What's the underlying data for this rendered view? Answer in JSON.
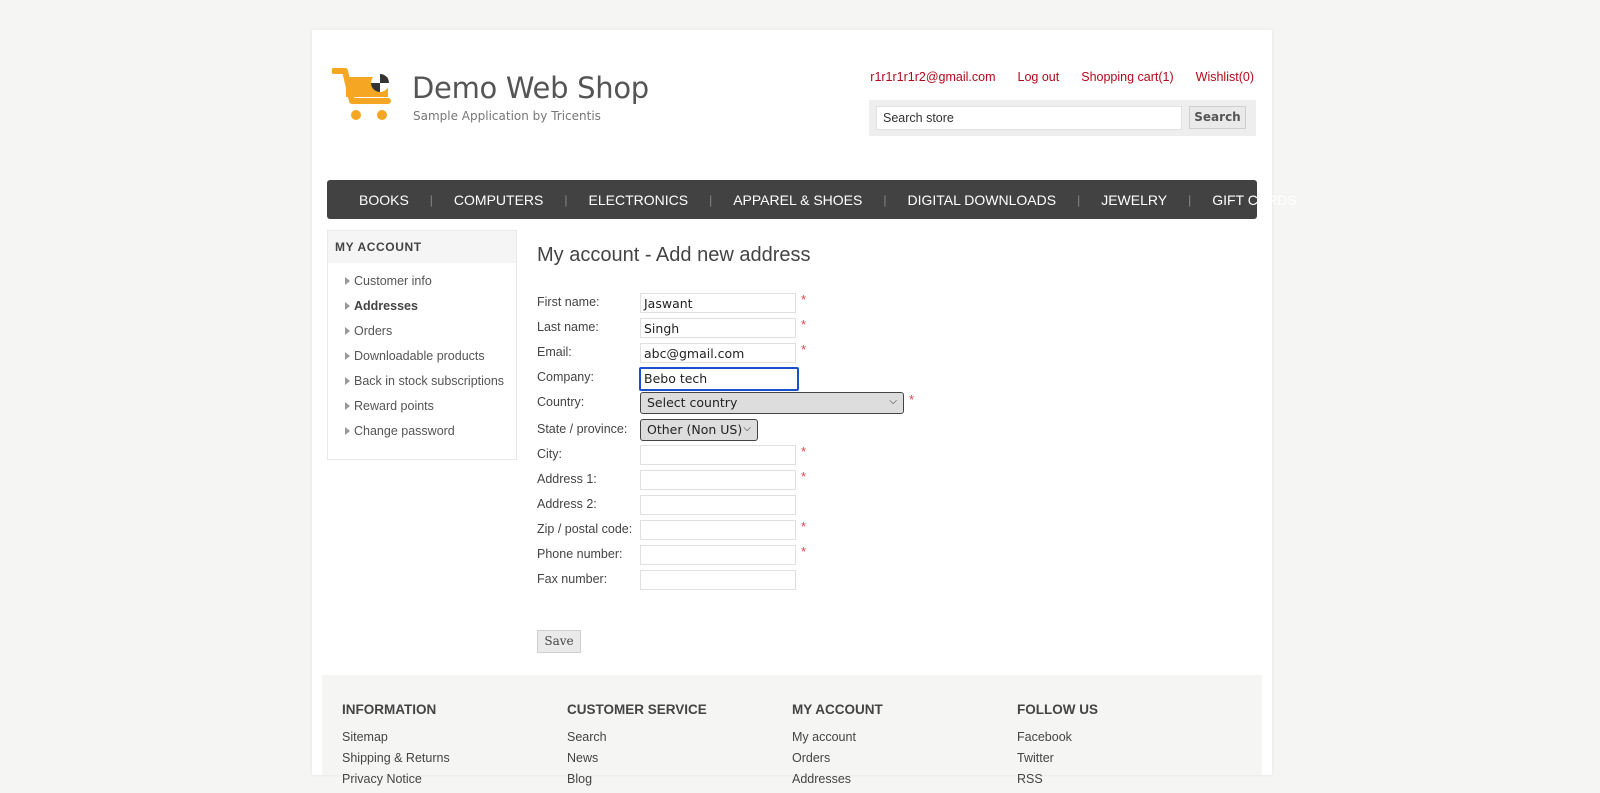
{
  "header": {
    "logo_title": "Demo Web Shop",
    "logo_subtitle": "Sample Application by Tricentis",
    "links": {
      "account_email": "r1r1r1r1r2@gmail.com",
      "logout": "Log out",
      "cart": "Shopping cart(1)",
      "wishlist": "Wishlist(0)"
    },
    "search": {
      "placeholder": "Search store",
      "value": "Search store",
      "button": "Search"
    }
  },
  "top_menu": [
    "BOOKS",
    "COMPUTERS",
    "ELECTRONICS",
    "APPAREL & SHOES",
    "DIGITAL DOWNLOADS",
    "JEWELRY",
    "GIFT CARDS"
  ],
  "sidebar": {
    "title": "MY ACCOUNT",
    "items": [
      {
        "label": "Customer info"
      },
      {
        "label": "Addresses"
      },
      {
        "label": "Orders"
      },
      {
        "label": "Downloadable products"
      },
      {
        "label": "Back in stock subscriptions"
      },
      {
        "label": "Reward points"
      },
      {
        "label": "Change password"
      }
    ]
  },
  "form": {
    "title": "My account - Add new address",
    "labels": {
      "first_name": "First name:",
      "last_name": "Last name:",
      "email": "Email:",
      "company": "Company:",
      "country": "Country:",
      "state": "State / province:",
      "city": "City:",
      "address1": "Address 1:",
      "address2": "Address 2:",
      "zip": "Zip / postal code:",
      "phone": "Phone number:",
      "fax": "Fax number:"
    },
    "values": {
      "first_name": "Jaswant",
      "last_name": "Singh",
      "email": "abc@gmail.com",
      "company": "Bebo tech",
      "country": "Select country",
      "state": "Other (Non US)",
      "city": "",
      "address1": "",
      "address2": "",
      "zip": "",
      "phone": "",
      "fax": ""
    },
    "required_mark": "*",
    "save": "Save"
  },
  "footer": {
    "columns": [
      {
        "title": "INFORMATION",
        "links": [
          "Sitemap",
          "Shipping & Returns",
          "Privacy Notice"
        ]
      },
      {
        "title": "CUSTOMER SERVICE",
        "links": [
          "Search",
          "News",
          "Blog"
        ]
      },
      {
        "title": "MY ACCOUNT",
        "links": [
          "My account",
          "Orders",
          "Addresses"
        ]
      },
      {
        "title": "FOLLOW US",
        "links": [
          "Facebook",
          "Twitter",
          "RSS"
        ]
      }
    ]
  },
  "colors": {
    "accent_link": "#b3081b",
    "menu_bg": "#424242",
    "required": "#e4444c",
    "focus": "#1a4fd0",
    "logo": "#f5a623"
  },
  "icons": [
    "shopping-cart-logo-icon",
    "chevron-down-icon",
    "arrow-right-icon"
  ]
}
